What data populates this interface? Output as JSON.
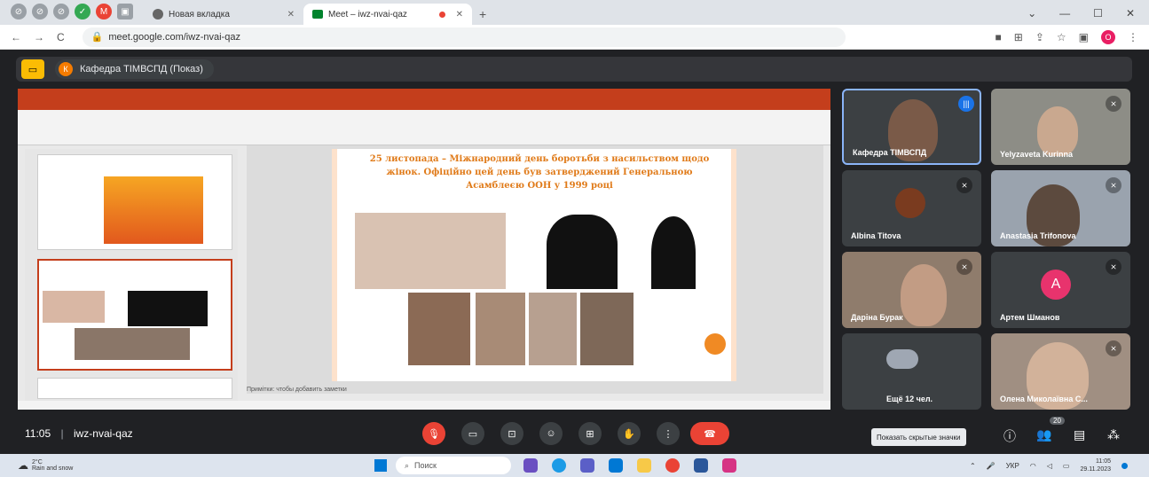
{
  "browser": {
    "tabs": [
      {
        "title": "Новая вкладка",
        "active": false
      },
      {
        "title": "Meet – iwz-nvai-qaz",
        "active": true
      }
    ],
    "new_tab_symbol": "+",
    "url": "meet.google.com/iwz-nvai-qaz",
    "profile_initial": "O"
  },
  "meet": {
    "presenter_label": "Кафедра ТІМВСПД (Показ)",
    "presenter_initial": "К",
    "meeting_time": "11:05",
    "meeting_code": "iwz-nvai-qaz",
    "participant_count": "20",
    "tooltip": "Показать скрытые значки",
    "participants": [
      {
        "name": "Кафедра ТІМВСПД",
        "speaking": true
      },
      {
        "name": "Yelyzaveta Kurinna",
        "muted": true
      },
      {
        "name": "Albina Titova",
        "muted": true
      },
      {
        "name": "Anastasia Trifonova",
        "muted": true
      },
      {
        "name": "Даріна Бурак",
        "muted": true
      },
      {
        "name": "Артем Шманов",
        "muted": true,
        "initial": "A"
      },
      {
        "name": "Ещё 12 чел."
      },
      {
        "name": "Олена Миколаївна С...",
        "muted": true
      }
    ]
  },
  "presentation": {
    "slide_title": "25 листопада – Міжнародний день боротьби з насильством щодо жінок. Офіційно цей день був затверджений Генеральною Асамблеєю ООН у 1999 році",
    "notes_placeholder": "Примітки: чтобы добавить заметки"
  },
  "taskbar": {
    "temperature": "2°C",
    "weather": "Rain and snow",
    "search_placeholder": "Поиск",
    "language": "УКР",
    "time": "11:05",
    "date": "29.11.2023"
  }
}
